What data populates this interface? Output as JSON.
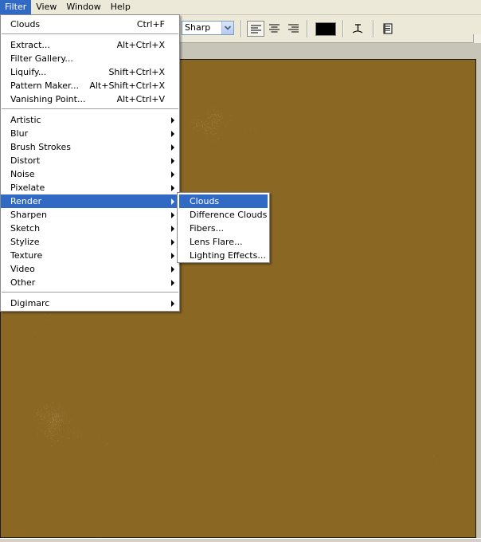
{
  "menubar": {
    "items": [
      {
        "label": "Filter",
        "active": true
      },
      {
        "label": "View",
        "active": false
      },
      {
        "label": "Window",
        "active": false
      },
      {
        "label": "Help",
        "active": false
      }
    ]
  },
  "options_bar": {
    "antialias_value": "Sharp",
    "text_color": "#000000",
    "icons": [
      "align-left-icon",
      "align-center-icon",
      "align-right-icon",
      "warp-text-icon",
      "palettes-icon"
    ]
  },
  "filter_menu": {
    "items": [
      {
        "label": "Clouds",
        "shortcut": "Ctrl+F",
        "has_submenu": false,
        "active": false
      },
      {
        "label": "Extract...",
        "shortcut": "Alt+Ctrl+X",
        "has_submenu": false,
        "active": false
      },
      {
        "label": "Filter Gallery...",
        "shortcut": "",
        "has_submenu": false,
        "active": false
      },
      {
        "label": "Liquify...",
        "shortcut": "Shift+Ctrl+X",
        "has_submenu": false,
        "active": false
      },
      {
        "label": "Pattern Maker...",
        "shortcut": "Alt+Shift+Ctrl+X",
        "has_submenu": false,
        "active": false
      },
      {
        "label": "Vanishing Point...",
        "shortcut": "Alt+Ctrl+V",
        "has_submenu": false,
        "active": false
      },
      {
        "label": "Artistic",
        "shortcut": "",
        "has_submenu": true,
        "active": false
      },
      {
        "label": "Blur",
        "shortcut": "",
        "has_submenu": true,
        "active": false
      },
      {
        "label": "Brush Strokes",
        "shortcut": "",
        "has_submenu": true,
        "active": false
      },
      {
        "label": "Distort",
        "shortcut": "",
        "has_submenu": true,
        "active": false
      },
      {
        "label": "Noise",
        "shortcut": "",
        "has_submenu": true,
        "active": false
      },
      {
        "label": "Pixelate",
        "shortcut": "",
        "has_submenu": true,
        "active": false
      },
      {
        "label": "Render",
        "shortcut": "",
        "has_submenu": true,
        "active": true
      },
      {
        "label": "Sharpen",
        "shortcut": "",
        "has_submenu": true,
        "active": false
      },
      {
        "label": "Sketch",
        "shortcut": "",
        "has_submenu": true,
        "active": false
      },
      {
        "label": "Stylize",
        "shortcut": "",
        "has_submenu": true,
        "active": false
      },
      {
        "label": "Texture",
        "shortcut": "",
        "has_submenu": true,
        "active": false
      },
      {
        "label": "Video",
        "shortcut": "",
        "has_submenu": true,
        "active": false
      },
      {
        "label": "Other",
        "shortcut": "",
        "has_submenu": true,
        "active": false
      },
      {
        "label": "Digimarc",
        "shortcut": "",
        "has_submenu": true,
        "active": false
      }
    ]
  },
  "render_submenu": {
    "items": [
      {
        "label": "Clouds",
        "active": true
      },
      {
        "label": "Difference Clouds",
        "active": false
      },
      {
        "label": "Fibers...",
        "active": false
      },
      {
        "label": "Lens Flare...",
        "active": false
      },
      {
        "label": "Lighting Effects...",
        "active": false
      }
    ]
  },
  "colors": {
    "highlight": "#316ac5",
    "canvas_dark": "#8e6a26",
    "canvas_light": "#f3d9a6"
  }
}
